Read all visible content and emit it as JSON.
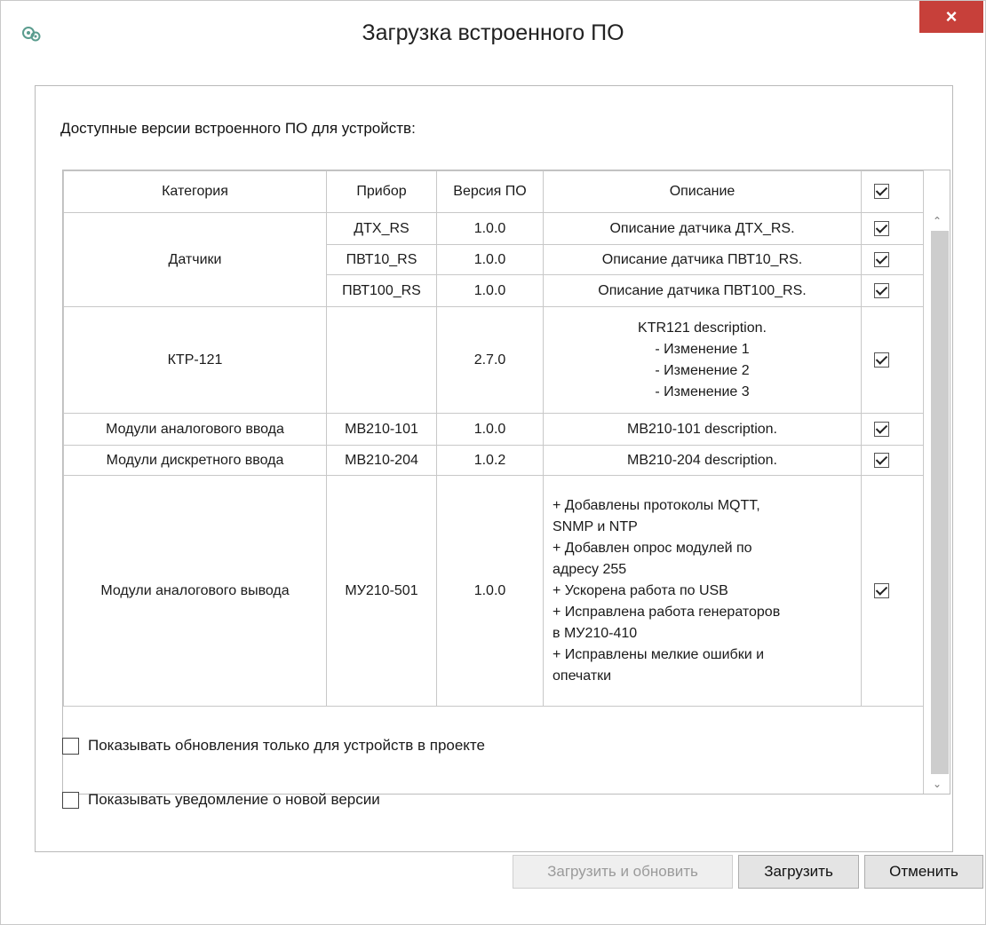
{
  "window": {
    "title": "Загрузка встроенного ПО",
    "close_label": "×",
    "accent_close_color": "#c7403a"
  },
  "group": {
    "heading": "Доступные версии встроенного ПО для устройств:"
  },
  "table": {
    "headers": [
      "Категория",
      "Прибор",
      "Версия ПО",
      "Описание"
    ],
    "header_checkbox_checked": true,
    "rows": [
      {
        "category": "Датчики",
        "device": "ДТХ_RS",
        "version": "1.0.0",
        "description": "Описание датчика ДТХ_RS.",
        "checked": true
      },
      {
        "category": "",
        "device": "ПВТ10_RS",
        "version": "1.0.0",
        "description": "Описание датчика ПВТ10_RS.",
        "checked": true
      },
      {
        "category": "",
        "device": "ПВТ100_RS",
        "version": "1.0.0",
        "description": "Описание датчика ПВТ100_RS.",
        "checked": true
      },
      {
        "category": "КТР-121",
        "device": "",
        "version": "2.7.0",
        "description_lines": [
          "KTR121 description.",
          "- Изменение 1",
          "- Изменение 2",
          "- Изменение 3"
        ],
        "checked": true
      },
      {
        "category": "Модули аналогового ввода",
        "device": "МВ210-101",
        "version": "1.0.0",
        "description": "MB210-101 description.",
        "checked": true
      },
      {
        "category": "Модули дискретного ввода",
        "device": "МВ210-204",
        "version": "1.0.2",
        "description": "MB210-204 description.",
        "checked": true
      },
      {
        "category": "Модули аналогового вывода",
        "device": "МУ210-501",
        "version": "1.0.0",
        "description_lines": [
          "+ Добавлены протоколы MQTT,",
          "SNMP и NTP",
          "+ Добавлен опрос модулей по",
          "адресу 255",
          "+ Ускорена работа по USB",
          "+ Исправлена работа генераторов",
          "в МУ210-410",
          "+ Исправлены мелкие ошибки и",
          "опечатки"
        ],
        "checked": true
      }
    ]
  },
  "options": {
    "only_project_devices": {
      "label": "Показывать обновления только для устройств в проекте",
      "checked": false
    },
    "notify_new_version": {
      "label": "Показывать уведомление о новой версии",
      "checked": false
    }
  },
  "buttons": {
    "download_update": "Загрузить и обновить",
    "download": "Загрузить",
    "cancel": "Отменить"
  },
  "icons": {
    "app": "firmware-gear-icon",
    "scroll_up": "chevron-up-icon",
    "scroll_down": "chevron-down-icon"
  }
}
